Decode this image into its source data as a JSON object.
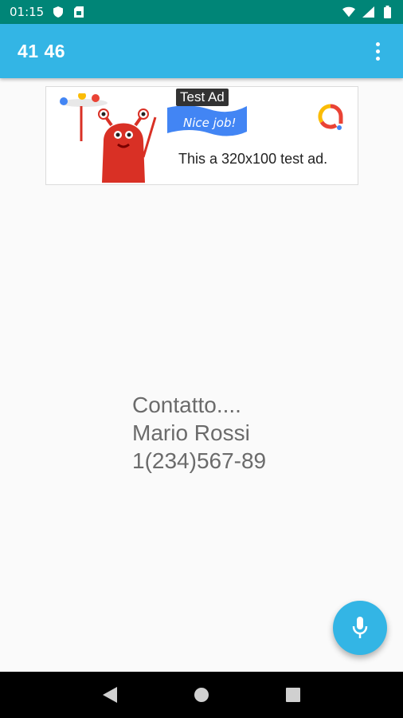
{
  "status_bar": {
    "time": "01:15",
    "icons": [
      "shield-icon",
      "sim-card-icon",
      "wifi-icon",
      "signal-icon",
      "battery-icon"
    ]
  },
  "app_bar": {
    "title": "41 46",
    "overflow_icon": "more-vert-icon"
  },
  "ad": {
    "label": "Test Ad",
    "flag_text": "Nice job!",
    "text": "This a 320x100 test ad."
  },
  "contact": {
    "line1": "Contatto....",
    "name": "Mario Rossi",
    "phone": "1(234)567-89"
  },
  "fab": {
    "icon": "microphone-icon",
    "color": "#33b5e5"
  },
  "nav_bar": {
    "buttons": [
      "back-icon",
      "home-icon",
      "recents-icon"
    ]
  },
  "colors": {
    "status_bar": "#008577",
    "app_bar": "#33b5e5",
    "background": "#fafafa",
    "text": "#6b6b6b"
  }
}
